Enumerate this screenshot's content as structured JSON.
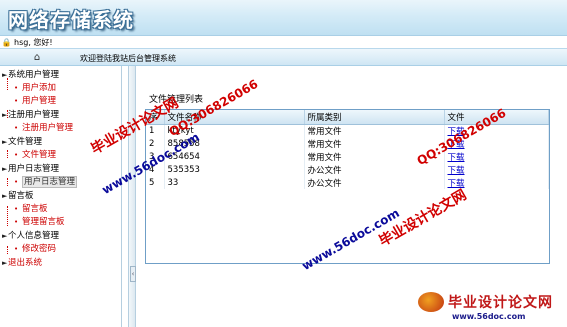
{
  "app": {
    "title": "网络存储系统"
  },
  "userbar": {
    "greeting": "hsg, 您好!"
  },
  "navbar": {
    "welcome": "欢迎登陆我站后台管理系统"
  },
  "sidebar": {
    "items": [
      {
        "label": "系统用户管理",
        "level": 0
      },
      {
        "label": "用户添加",
        "level": 1
      },
      {
        "label": "用户管理",
        "level": 1
      },
      {
        "label": "注册用户管理",
        "level": 0
      },
      {
        "label": "注册用户管理",
        "level": 1
      },
      {
        "label": "文件管理",
        "level": 0
      },
      {
        "label": "文件管理",
        "level": 1
      },
      {
        "label": "用户日志管理",
        "level": 0
      },
      {
        "label": "用户日志管理",
        "level": 1
      },
      {
        "label": "留言板",
        "level": 0
      },
      {
        "label": "留言板",
        "level": 1
      },
      {
        "label": "管理留言板",
        "level": 1
      },
      {
        "label": "个人信息管理",
        "level": 0
      },
      {
        "label": "修改密码",
        "level": 1
      },
      {
        "label": "退出系统",
        "level": 0
      }
    ]
  },
  "main": {
    "caption": "文件管理列表",
    "columns": [
      "序",
      "文件名称",
      "所属类别",
      "文件"
    ],
    "rows": [
      {
        "id": "1",
        "name": "ktykyt",
        "category": "常用文件",
        "action": "下载"
      },
      {
        "id": "2",
        "name": "858558",
        "category": "常用文件",
        "action": "下载"
      },
      {
        "id": "3",
        "name": "654654",
        "category": "常用文件",
        "action": "下载"
      },
      {
        "id": "4",
        "name": "535353",
        "category": "办公文件",
        "action": "下载"
      },
      {
        "id": "5",
        "name": "33",
        "category": "办公文件",
        "action": "下载"
      }
    ]
  },
  "watermarks": {
    "site_red": "毕业设计论文网",
    "site_url": "www.56doc.com",
    "qq": "QQ:306826066"
  },
  "brand": {
    "name": "毕业设计论文网",
    "url": "www.56doc.com"
  },
  "colors": {
    "accent": "#3b6f97",
    "tree_child": "#cc0000",
    "link": "#0000cc"
  }
}
